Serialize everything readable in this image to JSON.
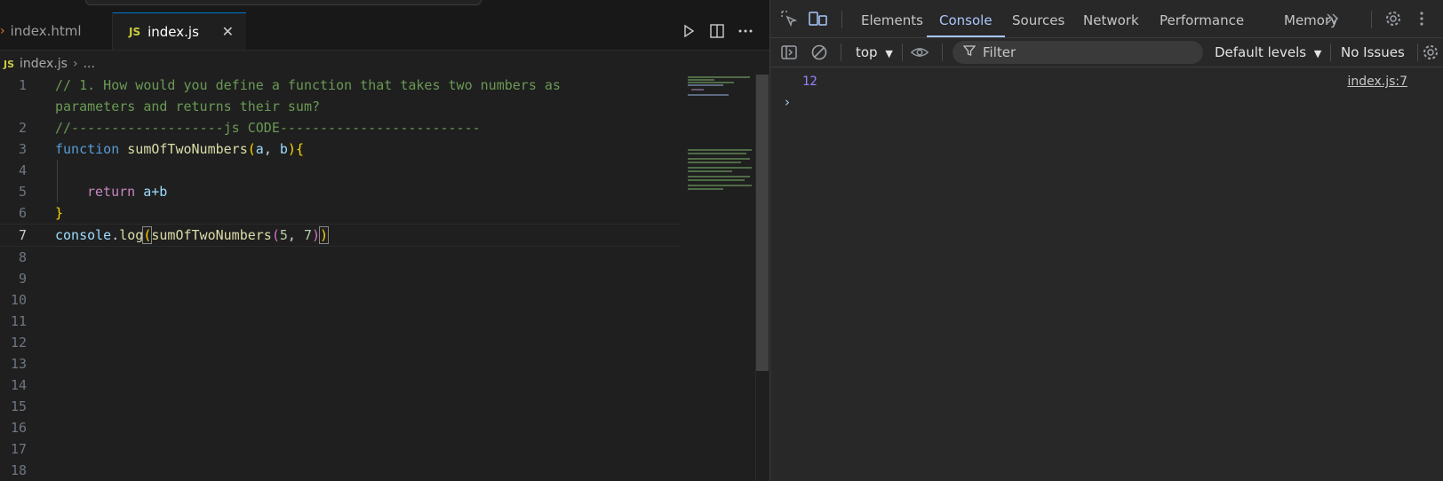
{
  "editor": {
    "tabs": [
      {
        "label": "index.html"
      },
      {
        "label": "index.js",
        "lang_badge": "JS"
      }
    ],
    "breadcrumb": {
      "badge": "JS",
      "file": "index.js",
      "rest": "..."
    },
    "line_numbers": [
      "1",
      "2",
      "3",
      "4",
      "5",
      "6",
      "7",
      "8",
      "9",
      "10",
      "11",
      "12",
      "13",
      "14",
      "15",
      "16",
      "17",
      "18"
    ],
    "code": {
      "l1a": "// 1. How would you define a function that takes two numbers as",
      "l1b": "parameters and returns their sum?",
      "l2": "//-------------------js CODE-------------------------",
      "l3_kw": "function",
      "l3_fn": "sumOfTwoNumbers",
      "l3_open": "(",
      "l3_a": "a",
      "l3_comma": ", ",
      "l3_b": "b",
      "l3_close": ")",
      "l3_brace": "{",
      "l5_ret": "return",
      "l5_expr": "a+b",
      "l6_brace": "}",
      "l7_obj": "console",
      "l7_dot": ".",
      "l7_fn": "log",
      "l7_open": "(",
      "l7_fn2": "sumOfTwoNumbers",
      "l7_open2": "(",
      "l7_n1": "5",
      "l7_comma": ", ",
      "l7_n2": "7",
      "l7_close2": ")",
      "l7_close": ")"
    }
  },
  "devtools": {
    "tabs": [
      "Elements",
      "Console",
      "Sources",
      "Network",
      "Performance",
      "Memory"
    ],
    "selected_tab": "Console",
    "more_tabs_icon": "chevron-double-right-icon",
    "context": "top",
    "filter_placeholder": "Filter",
    "levels": "Default levels",
    "issues": "No Issues",
    "console_output": "12",
    "console_source": "index.js:7",
    "prompt_symbol": "›"
  },
  "colors": {
    "accent": "#a8c7fa",
    "comment": "#6a9955",
    "keyword": "#569cd6",
    "function": "#dcdcaa",
    "output_number": "#9980ff"
  }
}
